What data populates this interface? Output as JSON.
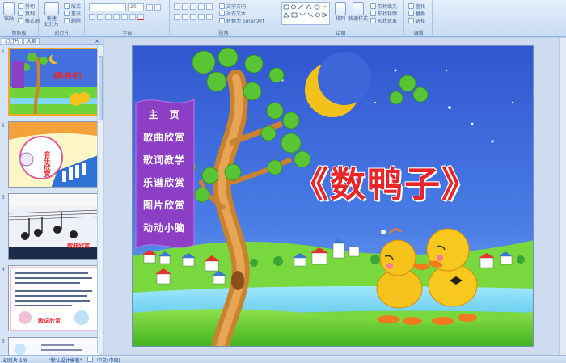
{
  "ribbon": {
    "clipboard": {
      "paste": "粘贴",
      "cut": "剪切",
      "copy": "复制",
      "format_painter": "格式刷",
      "label": "剪贴板"
    },
    "slides": {
      "new_slide": "新建\n幻灯片",
      "layout": "版式",
      "reset": "重设",
      "delete": "删除",
      "label": "幻灯片"
    },
    "font": {
      "size": "20",
      "label": "字体"
    },
    "paragraph": {
      "text_direction": "文字方向",
      "align_text": "对齐文本",
      "smartart": "转换为 SmartArt",
      "label": "段落"
    },
    "drawing": {
      "arrange": "排列",
      "quick_styles": "快速样式",
      "shape_fill": "形状填充",
      "shape_outline": "形状轮廓",
      "shape_effects": "形状效果",
      "label": "绘图"
    },
    "editing": {
      "find": "查找",
      "replace": "替换",
      "select": "选择",
      "label": "编辑"
    }
  },
  "panel": {
    "tabs": [
      "幻灯片",
      "大纲"
    ],
    "close": "×",
    "thumbs": [
      {
        "num": "1",
        "title": "《数鸭子》"
      },
      {
        "num": "2",
        "title": "音乐欣赏"
      },
      {
        "num": "3",
        "title": "歌曲欣赏"
      },
      {
        "num": "4",
        "title": "歌词欣赏"
      },
      {
        "num": "5",
        "title": ""
      }
    ]
  },
  "slide": {
    "menu": [
      "主　页",
      "歌曲欣赏",
      "歌词教学",
      "乐谱欣赏",
      "图片欣赏",
      "动动小脑"
    ],
    "title": "《数鸭子》"
  },
  "status": {
    "slide_count": "幻灯片 1/9",
    "theme": "\"默认设计模板\"",
    "language": "中文(中国)"
  },
  "colors": {
    "sky": "#3d63d6",
    "grass": "#6fd33a",
    "menu_purple": "#8c3ec4",
    "title_red": "#e8262a",
    "moon": "#f2c21a"
  }
}
